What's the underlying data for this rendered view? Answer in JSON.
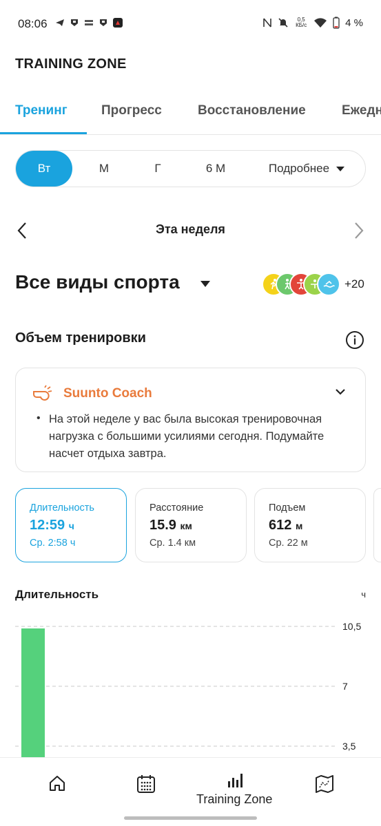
{
  "status_bar": {
    "time": "08:06",
    "speed_top": "0,5",
    "speed_bottom": "КБ/с",
    "battery": "4 %",
    "left_icons": [
      "telegram-icon",
      "shield-icon",
      "bank-icon",
      "shield-icon",
      "app-icon"
    ],
    "right_icons": [
      "nfc-icon",
      "mute-icon",
      "wifi-icon",
      "battery-icon"
    ]
  },
  "header": {
    "title": "TRAINING ZONE"
  },
  "tabs": [
    {
      "label": "Тренинг",
      "active": true
    },
    {
      "label": "Прогресс",
      "active": false
    },
    {
      "label": "Восстановление",
      "active": false
    },
    {
      "label": "Ежедн",
      "active": false
    }
  ],
  "period": {
    "options": [
      "Вт",
      "М",
      "Г",
      "6 М"
    ],
    "more": "Подробнее",
    "selected": "Вт"
  },
  "week": {
    "label": "Эта неделя"
  },
  "sport": {
    "title": "Все виды спорта",
    "more_count": "+20",
    "icon_colors": [
      "#f4d21a",
      "#6cc86c",
      "#e2453a",
      "#9bd34a",
      "#4fc3ea"
    ]
  },
  "volume": {
    "title": "Объем тренировки"
  },
  "coach": {
    "title": "Suunto Coach",
    "message": "На этой неделе у вас была высокая тренировочная нагрузка с большими усилиями сегодня. Подумайте насчет отдыха завтра."
  },
  "stats": [
    {
      "label": "Длительность",
      "value": "12:59",
      "unit": "ч",
      "avg": "Ср. 2:58 ч",
      "active": true
    },
    {
      "label": "Расстояние",
      "value": "15.9",
      "unit": "км",
      "avg": "Ср. 1.4 км",
      "active": false
    },
    {
      "label": "Подъем",
      "value": "612",
      "unit": "м",
      "avg": "Ср. 22 м",
      "active": false
    }
  ],
  "chart_data": {
    "type": "bar",
    "title": "Длительность",
    "ylabel": "ч",
    "ytick_labels": [
      "10,5",
      "7",
      "3,5"
    ],
    "ticks": [
      10.5,
      7,
      3.5
    ],
    "ylim": [
      0,
      10.5
    ],
    "categories": [
      "1"
    ],
    "values": [
      10.5
    ],
    "bar_color": "#55d17c"
  },
  "bottom_nav": {
    "items": [
      "home-icon",
      "calendar-icon",
      "training-zone-icon",
      "map-icon"
    ],
    "active_label": "Training Zone"
  },
  "colors": {
    "accent": "#1aa3de",
    "coach": "#e97b3c",
    "bar": "#55d17c"
  }
}
